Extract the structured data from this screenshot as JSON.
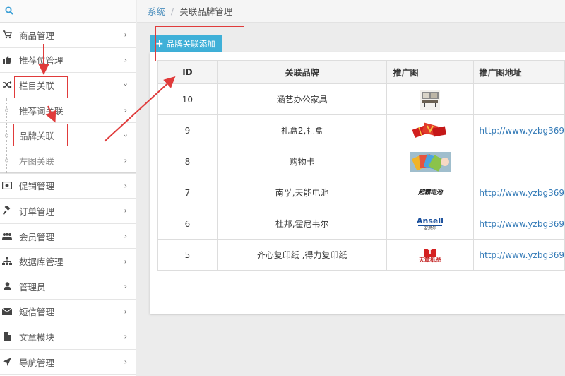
{
  "breadcrumb": {
    "root": "系统",
    "separator": "/",
    "current": "关联品牌管理"
  },
  "sidebar": {
    "items": [
      {
        "label": "商品管理",
        "icon": "cart-icon"
      },
      {
        "label": "推荐位管理",
        "icon": "thumbs-up-icon"
      },
      {
        "label": "栏目关联",
        "icon": "shuffle-icon",
        "expanded": true
      },
      {
        "label": "推荐词关联",
        "sub": true
      },
      {
        "label": "品牌关联",
        "sub": true,
        "active": true
      },
      {
        "label": "左图关联",
        "sub": true
      },
      {
        "label": "促销管理",
        "icon": "money-icon"
      },
      {
        "label": "订单管理",
        "icon": "gavel-icon"
      },
      {
        "label": "会员管理",
        "icon": "users-icon"
      },
      {
        "label": "数据库管理",
        "icon": "sitemap-icon"
      },
      {
        "label": "管理员",
        "icon": "user-icon"
      },
      {
        "label": "短信管理",
        "icon": "envelope-icon"
      },
      {
        "label": "文章模块",
        "icon": "file-icon"
      },
      {
        "label": "导航管理",
        "icon": "location-arrow-icon"
      }
    ]
  },
  "toolbar": {
    "add_label": "品牌关联添加"
  },
  "table": {
    "headers": [
      "ID",
      "关联品牌",
      "推广图",
      "推广图地址"
    ],
    "rows": [
      {
        "id": "10",
        "brand": "涵艺办公家具",
        "thumb": "furniture",
        "url": ""
      },
      {
        "id": "9",
        "brand": "礼盒2,礼盒",
        "thumb": "giftbox",
        "url": "http://www.yzbg369"
      },
      {
        "id": "8",
        "brand": "购物卡",
        "thumb": "cards",
        "url": ""
      },
      {
        "id": "7",
        "brand": "南孚,天能电池",
        "thumb": "battery-logo",
        "url": "http://www.yzbg369"
      },
      {
        "id": "6",
        "brand": "杜邦,霍尼韦尔",
        "thumb": "ansell-logo",
        "url": "http://www.yzbg369"
      },
      {
        "id": "5",
        "brand": "齐心复印纸 ,得力复印纸",
        "thumb": "paper-logo",
        "url": "http://www.yzbg369"
      }
    ]
  },
  "thumb_text": {
    "battery": "超霸电池",
    "ansell_main": "Ansell",
    "ansell_sub": "安思尔",
    "paper_mark": "T",
    "paper_text": "天章纸品"
  },
  "colors": {
    "accent": "#3fb0d8",
    "link": "#4c8fbd",
    "annotation": "#e03b3b"
  }
}
